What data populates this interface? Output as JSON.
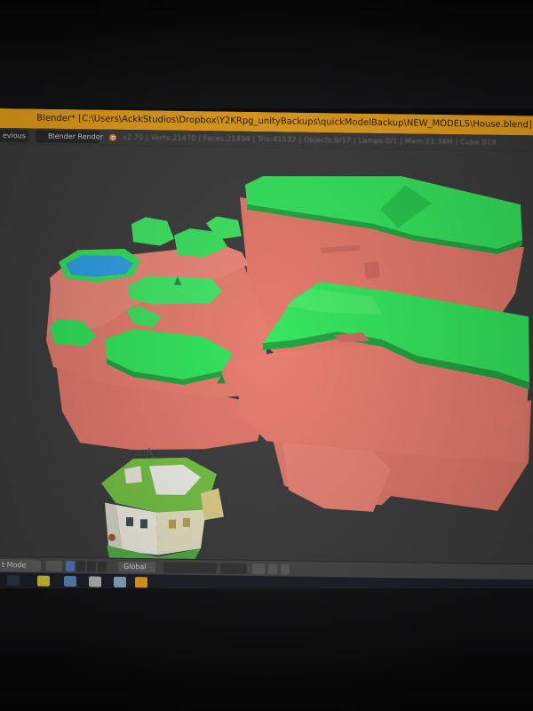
{
  "window": {
    "title": "Blender* [C:\\Users\\AckkStudios\\Dropbox\\Y2KRpg_unityBackups\\quickModelBackup\\NEW_MODELS\\House.blend]"
  },
  "info_header": {
    "previous_label": "evious",
    "render_engine": "Blender Render",
    "stats": "v2.70 | Verts:21470 | Faces:21494 | Tris:41532 | Objects:0/17 | Lamps:0/1 | Mem:21.34M | Cube.019"
  },
  "view3d_header": {
    "mode_label": "t Mode",
    "orientation": "Global"
  },
  "colors": {
    "title_bar": "#e8a11b",
    "terrain_grass": "#2fe35a",
    "terrain_cliff": "#e87b6e",
    "water": "#2f9fe8",
    "viewport_bg": "#3c3c3c"
  },
  "icons": [
    "blender-logo-icon",
    "viewport-shading-icon",
    "pivot-icon",
    "manipulator-icons",
    "layer-icons",
    "snap-icon",
    "render-icon",
    "taskbar-icons"
  ]
}
